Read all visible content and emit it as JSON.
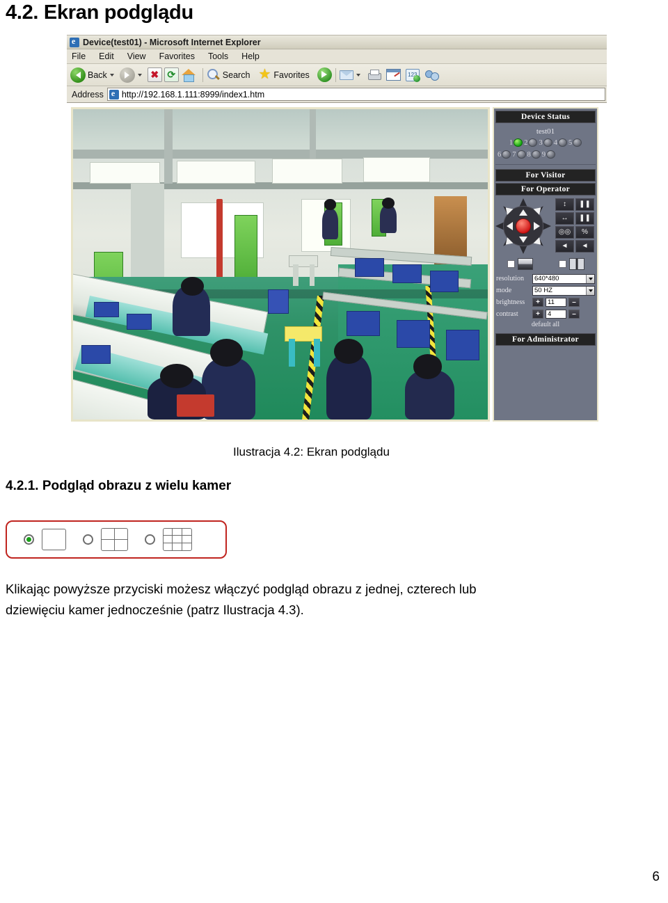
{
  "document": {
    "heading1": "4.2. Ekran podglądu",
    "figure_caption": "Ilustracja 4.2: Ekran podglądu",
    "heading2": "4.2.1. Podgląd obrazu z wielu kamer",
    "paragraph_line1": "Klikając powyższe przyciski możesz włączyć podgląd obrazu z jednej, czterech lub",
    "paragraph_line2": "dziewięciu kamer jednocześnie (patrz Ilustracja 4.3).",
    "page_number": "6"
  },
  "browser": {
    "title": "Device(test01) - Microsoft Internet Explorer",
    "menus": [
      {
        "label": "File"
      },
      {
        "label": "Edit"
      },
      {
        "label": "View"
      },
      {
        "label": "Favorites"
      },
      {
        "label": "Tools"
      },
      {
        "label": "Help"
      }
    ],
    "toolbar": {
      "back_label": "Back",
      "search_label": "Search",
      "favorites_label": "Favorites"
    },
    "address": {
      "label": "Address",
      "url": "http://192.168.1.111:8999/index1.htm"
    }
  },
  "device_panel": {
    "status_header": "Device Status",
    "device_name": "test01",
    "leds_row1": [
      {
        "num": "1",
        "state": "on"
      },
      {
        "num": "2",
        "state": "off"
      },
      {
        "num": "3",
        "state": "off"
      },
      {
        "num": "4",
        "state": "off"
      },
      {
        "num": "5",
        "state": "off"
      }
    ],
    "leds_row2": [
      {
        "num": "6",
        "state": "off"
      },
      {
        "num": "7",
        "state": "off"
      },
      {
        "num": "8",
        "state": "off"
      },
      {
        "num": "9",
        "state": "off"
      }
    ],
    "visitor_bar": "For Visitor",
    "operator_bar": "For Operator",
    "administrator_bar": "For Administrator",
    "function_buttons": [
      {
        "glyph": "↕",
        "name": "vertical-scan"
      },
      {
        "glyph": "❚❚",
        "name": "pause-vertical"
      },
      {
        "glyph": "↔",
        "name": "horizontal-scan"
      },
      {
        "glyph": "❚❚",
        "name": "pause-horizontal"
      },
      {
        "glyph": "◎◎",
        "name": "binocular"
      },
      {
        "glyph": "%",
        "name": "scissors"
      },
      {
        "glyph": "◄",
        "name": "light-on"
      },
      {
        "glyph": "◄",
        "name": "light-off"
      }
    ],
    "settings": {
      "resolution_label": "resolution",
      "resolution_value": "640*480",
      "mode_label": "mode",
      "mode_value": "50 HZ",
      "brightness_label": "brightness",
      "brightness_value": "11",
      "contrast_label": "contrast",
      "contrast_value": "4",
      "plus": "+",
      "minus": "–",
      "default_all": "default all"
    }
  },
  "camera_layout": {
    "options": [
      {
        "name": "single",
        "selected": true
      },
      {
        "name": "quad",
        "selected": false
      },
      {
        "name": "nine",
        "selected": false
      }
    ]
  },
  "colors": {
    "panel_bg": "#6f7585",
    "panel_header": "#232323",
    "led_on": "#14a511",
    "accent_red": "#c0241f",
    "joystick_center": "#cf1414"
  }
}
